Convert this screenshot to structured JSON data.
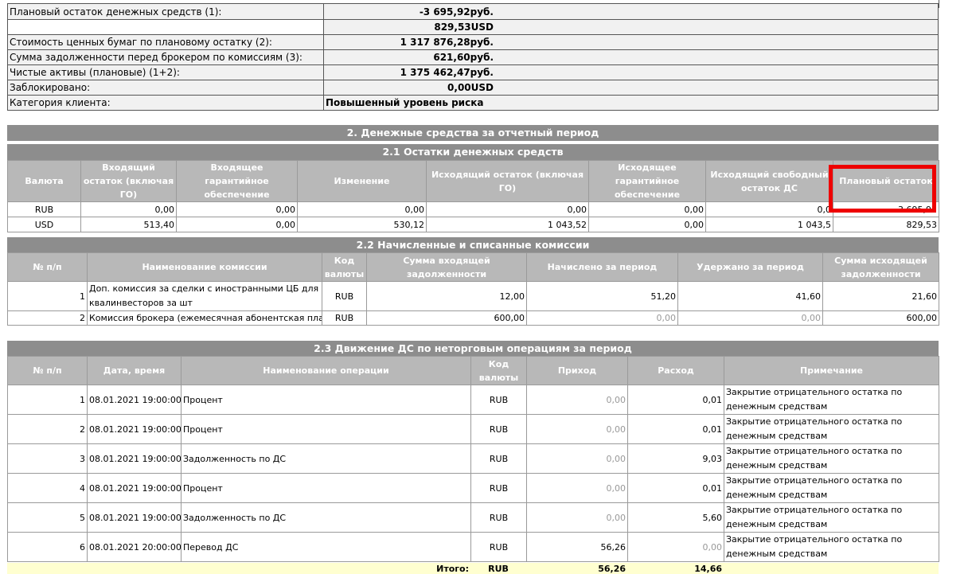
{
  "summary": {
    "rows": [
      {
        "label": "Плановый остаток денежных средств (1):",
        "value": "-3 695,92руб."
      },
      {
        "label": "",
        "value": "829,53USD"
      },
      {
        "label": "Стоимость ценных бумаг по плановому остатку (2):",
        "value": "1 317 876,28руб."
      },
      {
        "label": "Сумма задолженности перед брокером по комиссиям (3):",
        "value": "621,60руб."
      },
      {
        "label": "Чистые активы (плановые) (1+2):",
        "value": "1 375 462,47руб."
      },
      {
        "label": "Заблокировано:",
        "value": "0,00USD"
      },
      {
        "label": "Категория клиента:",
        "value": "Повышенный уровень риска"
      }
    ]
  },
  "section2": {
    "title": "2. Денежные средства за отчетный период"
  },
  "section21": {
    "title": "2.1 Остатки денежных средств",
    "headers": [
      "Валюта",
      "Входящий остаток (включая ГО)",
      "Входящее гарантийное обеспечение",
      "Изменение",
      "Исходящий остаток (включая ГО)",
      "Исходящее гарантийное обеспечение",
      "Исходящий свободный остаток ДС",
      "Плановый остаток"
    ],
    "rows": [
      [
        "RUB",
        "0,00",
        "0,00",
        "0,00",
        "0,00",
        "0,00",
        "0,0",
        "-3 695,92"
      ],
      [
        "USD",
        "513,40",
        "0,00",
        "530,12",
        "1 043,52",
        "0,00",
        "1 043,5",
        "829,53"
      ]
    ]
  },
  "section22": {
    "title": "2.2 Начисленные и списанные комиссии",
    "headers": [
      "№ п/п",
      "Наименование комиссии",
      "Код валюты",
      "Сумма входящей задолженности",
      "Начислено за период",
      "Удержано за период",
      "Сумма исходящей задолженности"
    ],
    "rows": [
      [
        "1",
        "Доп. комиссия за сделки с иностранными ЦБ для квалинвесторов за шт",
        "RUB",
        "12,00",
        "51,20",
        "41,60",
        "21,60"
      ],
      [
        "2",
        "Комиссия брокера (ежемесячная абонентская плата)",
        "RUB",
        "600,00",
        "0,00",
        "0,00",
        "600,00"
      ]
    ]
  },
  "section23": {
    "title": "2.3 Движение ДС по неторговым операциям за период",
    "headers": [
      "№ п/п",
      "Дата, время",
      "Наименование операции",
      "Код валюты",
      "Приход",
      "Расход",
      "Примечание"
    ],
    "rows": [
      [
        "1",
        "08.01.2021 19:00:00",
        "Процент",
        "RUB",
        "0,00",
        "0,01",
        "Закрытие отрицательного остатка по денежным средствам"
      ],
      [
        "2",
        "08.01.2021 19:00:00",
        "Процент",
        "RUB",
        "0,00",
        "0,01",
        "Закрытие отрицательного остатка по денежным средствам"
      ],
      [
        "3",
        "08.01.2021 19:00:00",
        "Задолженность по ДС",
        "RUB",
        "0,00",
        "9,03",
        "Закрытие отрицательного остатка по денежным средствам"
      ],
      [
        "4",
        "08.01.2021 19:00:00",
        "Процент",
        "RUB",
        "0,00",
        "0,01",
        "Закрытие отрицательного остатка по денежным средствам"
      ],
      [
        "5",
        "08.01.2021 19:00:00",
        "Задолженность по ДС",
        "RUB",
        "0,00",
        "5,60",
        "Закрытие отрицательного остатка по денежным средствам"
      ],
      [
        "6",
        "08.01.2021 20:00:00",
        "Перевод ДС",
        "RUB",
        "56,26",
        "0,00",
        "Закрытие отрицательного остатка по денежным средствам"
      ]
    ],
    "total": {
      "label": "Итого:",
      "currency": "RUB",
      "income": "56,26",
      "expense": "14,66"
    }
  },
  "colors": {
    "header_bg": "#8d8d8d",
    "subheader_bg": "#b8b8b8",
    "highlight_border": "#ee0000",
    "total_bg": "#ffffd0"
  }
}
